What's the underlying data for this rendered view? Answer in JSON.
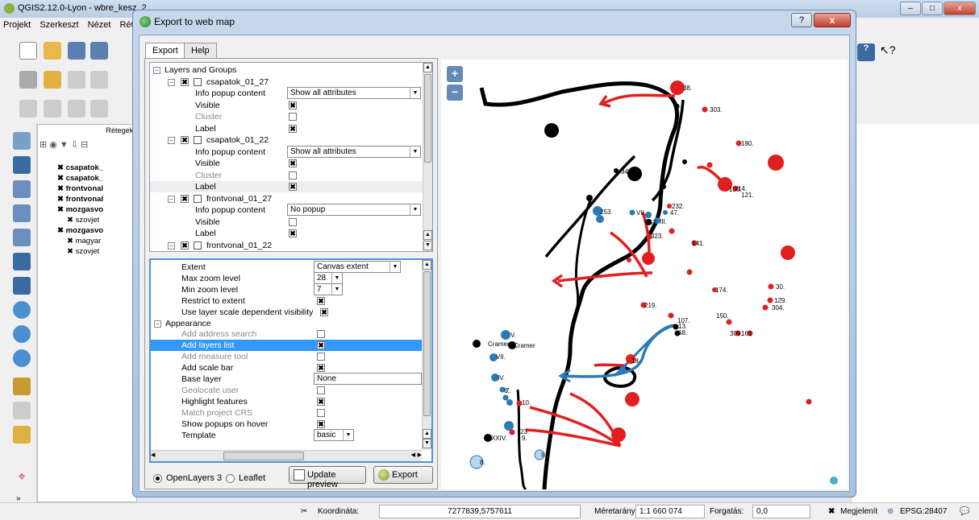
{
  "qgis": {
    "title": "QGIS2.12.0-Lyon - wbre_kesz_2",
    "menu": [
      "Projekt",
      "Szerkeszt",
      "Nézet",
      "Réte"
    ],
    "layers_header": "Rétegek",
    "layers": [
      {
        "label": "csapatok_",
        "bold": true
      },
      {
        "label": "csapatok_",
        "bold": true
      },
      {
        "label": "frontvonal",
        "bold": true
      },
      {
        "label": "frontvonal",
        "bold": true
      },
      {
        "label": "mozgasvo",
        "bold": true
      },
      {
        "label": "szovjet",
        "bold": false
      },
      {
        "label": "mozgasvo",
        "bold": true
      },
      {
        "label": "magyar",
        "bold": false
      },
      {
        "label": "szovjet",
        "bold": false
      }
    ]
  },
  "status": {
    "coord_label": "Koordináta:",
    "coord_value": "7277839,5757611",
    "scale_label": "Méretarány",
    "scale_value": "1:1 660 074",
    "rotation_label": "Forgatás:",
    "rotation_value": "0,0",
    "render_label": "Megjelenít",
    "crs": "EPSG:28407"
  },
  "dialog": {
    "title": "Export to web map",
    "help_btn": "?",
    "close_btn": "x",
    "tabs": [
      "Export",
      "Help"
    ],
    "layer_tree": {
      "group": "Layers and Groups",
      "items": [
        {
          "name": "csapatok_01_27",
          "popup_label": "Info popup content",
          "popup_value": "Show all attributes",
          "visible": true,
          "cluster": false,
          "label": true
        },
        {
          "name": "csapatok_01_22",
          "popup_label": "Info popup content",
          "popup_value": "Show all attributes",
          "visible": true,
          "cluster": false,
          "label": true
        },
        {
          "name": "frontvonal_01_27",
          "popup_label": "Info popup content",
          "popup_value": "No popup",
          "visible": false,
          "label": true
        },
        {
          "name": "frontvonal_01_22"
        }
      ],
      "sub_labels": {
        "visible": "Visible",
        "cluster": "Cluster",
        "label": "Label"
      }
    },
    "settings": {
      "extent_label": "Extent",
      "extent_value": "Canvas extent",
      "max_zoom_label": "Max zoom level",
      "max_zoom_value": "28",
      "min_zoom_label": "Min zoom level",
      "min_zoom_value": "7",
      "restrict_label": "Restrict to extent",
      "scale_vis_label": "Use layer scale dependent visibility",
      "appearance_label": "Appearance",
      "add_address_search": "Add address search",
      "add_layers_list": "Add layers list",
      "add_measure_tool": "Add measure tool",
      "add_scale_bar": "Add scale bar",
      "base_layer_label": "Base layer",
      "base_layer_value": "None",
      "geolocate_label": "Geolocate user",
      "highlight_label": "Highlight features",
      "match_crs_label": "Match project CRS",
      "popups_hover_label": "Show popups on hover",
      "template_label": "Template",
      "template_value": "basic"
    },
    "bottom": {
      "openlayers_label": "OpenLayers 3",
      "leaflet_label": "Leaflet",
      "update_preview": "Update preview",
      "export": "Export"
    },
    "zoom_in": "+",
    "zoom_out": "−",
    "map_labels": [
      "38.",
      "303.",
      "180.",
      "100.",
      "14.",
      "121.",
      "232.",
      "47.",
      "141.",
      "174.",
      "150.",
      "30.",
      "129.",
      "304.",
      "107.",
      "309.",
      "161",
      "219.",
      "340.",
      "253.",
      "VII.",
      "III.",
      "9.",
      "6.",
      "V.",
      "Cramer",
      "7.",
      "10.",
      "23.",
      "XXIV.",
      "8.",
      "18.",
      "II.",
      "VII.",
      "IV.",
      "13.",
      "68.",
      "Cramer",
      "52.",
      "323."
    ]
  }
}
